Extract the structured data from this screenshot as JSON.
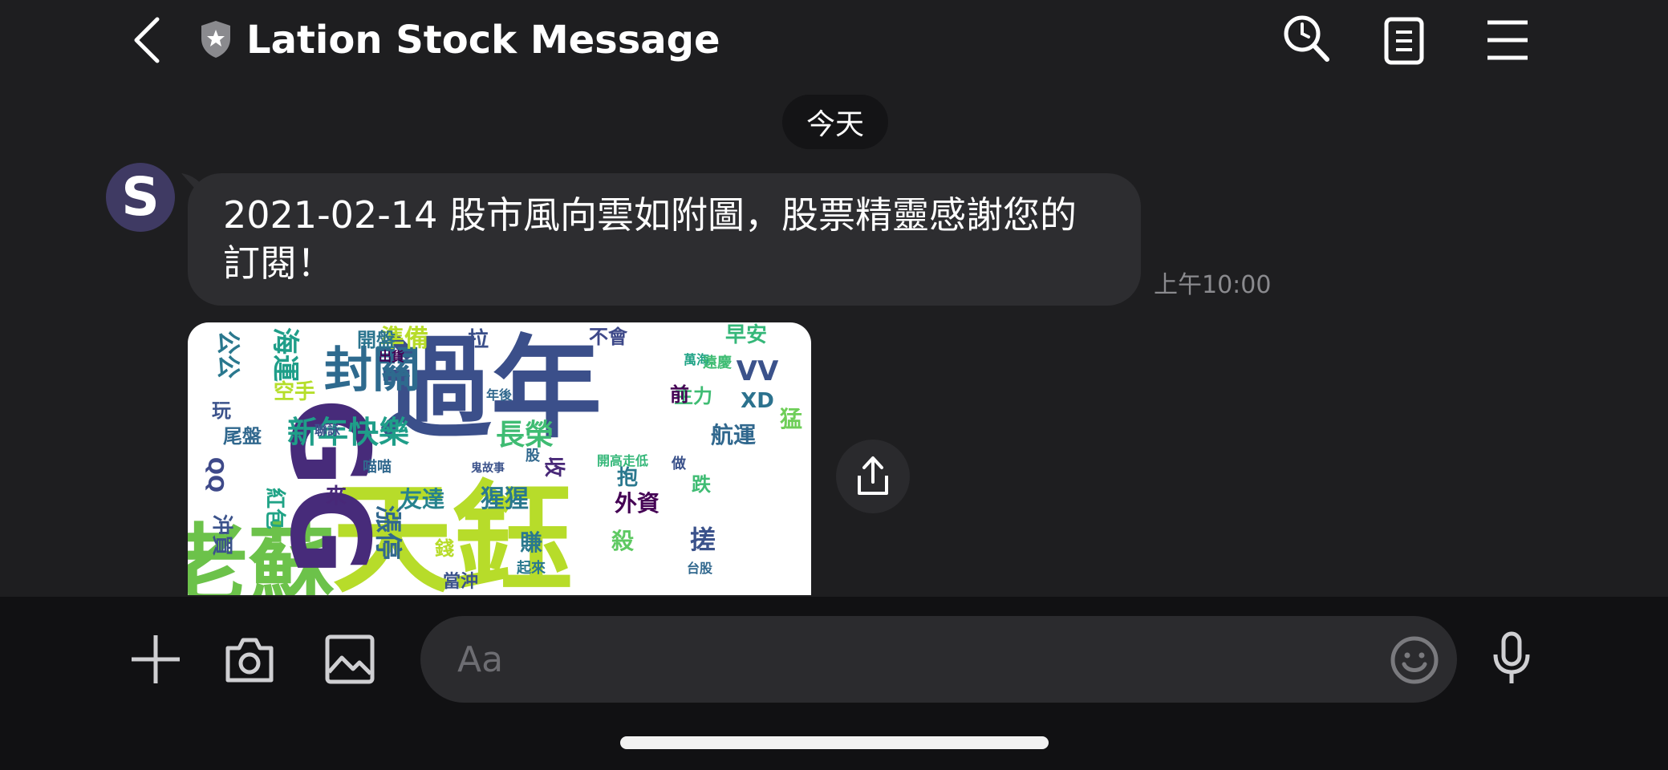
{
  "header": {
    "title": "Lation Stock Message",
    "icons": [
      "back-chevron-icon",
      "verified-shield-icon",
      "search-clock-icon",
      "notes-icon",
      "menu-icon"
    ]
  },
  "chat": {
    "date_label": "今天",
    "avatar_letter": "S",
    "message_text": "2021-02-14 股市風向雲如附圖，股票精靈感謝您的訂閱！",
    "message_time": "上午10:00",
    "wordcloud_words": [
      {
        "text": "過年",
        "color": "#3b4f8a"
      },
      {
        "text": "天鈺",
        "color": "#b7dc2a"
      },
      {
        "text": "老蘇",
        "color": "#6cc24a"
      },
      {
        "text": "GG",
        "color": "#472b7a"
      },
      {
        "text": "封關",
        "color": "#2e6a8e"
      },
      {
        "text": "新年快樂",
        "color": "#1f9e89"
      },
      {
        "text": "長榮",
        "color": "#3fbc73"
      },
      {
        "text": "準備",
        "color": "#b7dc2a"
      },
      {
        "text": "開盤",
        "color": "#2b748e"
      },
      {
        "text": "拉",
        "color": "#3b4f8a"
      },
      {
        "text": "不會",
        "color": "#3e4989"
      },
      {
        "text": "早安",
        "color": "#35b779"
      },
      {
        "text": "VV",
        "color": "#3b528b"
      },
      {
        "text": "XD",
        "color": "#2c728e"
      },
      {
        "text": "主力",
        "color": "#3fbc73"
      },
      {
        "text": "航運",
        "color": "#31688e"
      },
      {
        "text": "猛",
        "color": "#6ece58"
      },
      {
        "text": "海運",
        "color": "#1f9e89"
      },
      {
        "text": "公公",
        "color": "#2a788e"
      },
      {
        "text": "空手",
        "color": "#b5de2b"
      },
      {
        "text": "玩",
        "color": "#3b528b"
      },
      {
        "text": "尾盤",
        "color": "#31688e"
      },
      {
        "text": "QQ",
        "color": "#3e4989"
      },
      {
        "text": "紅包",
        "color": "#20a386"
      },
      {
        "text": "沖買",
        "color": "#3b528b"
      },
      {
        "text": "漲停",
        "color": "#31688e"
      },
      {
        "text": "友達",
        "color": "#26828e"
      },
      {
        "text": "猩猩",
        "color": "#2a788e"
      },
      {
        "text": "外資",
        "color": "#440154"
      },
      {
        "text": "跌",
        "color": "#3fbc73"
      },
      {
        "text": "搓",
        "color": "#3b528b"
      },
      {
        "text": "殺",
        "color": "#5ec962"
      },
      {
        "text": "賺",
        "color": "#2a788e"
      },
      {
        "text": "錢",
        "color": "#b7dc2a"
      },
      {
        "text": "前",
        "color": "#440154"
      },
      {
        "text": "當沖",
        "color": "#3b528b"
      },
      {
        "text": "收",
        "color": "#482878"
      },
      {
        "text": "來",
        "color": "#482878"
      },
      {
        "text": "抱",
        "color": "#2a788e"
      },
      {
        "text": "開高走低",
        "color": "#35b779"
      },
      {
        "text": "起來",
        "color": "#2a788e"
      },
      {
        "text": "台股",
        "color": "#31688e"
      },
      {
        "text": "做",
        "color": "#3b528b"
      },
      {
        "text": "聯詠",
        "color": "#3b528b"
      },
      {
        "text": "喵喵",
        "color": "#31688e"
      },
      {
        "text": "股",
        "color": "#31688e"
      },
      {
        "text": "出貨",
        "color": "#440154"
      },
      {
        "text": "鬼故事",
        "color": "#3b528b"
      },
      {
        "text": "年後",
        "color": "#31688e"
      },
      {
        "text": "萬海",
        "color": "#20a386"
      },
      {
        "text": "遠慶",
        "color": "#3fbc73"
      }
    ]
  },
  "composer": {
    "placeholder": "Aa",
    "icons": [
      "plus-icon",
      "camera-icon",
      "image-icon",
      "emoji-icon",
      "microphone-icon"
    ]
  },
  "colors": {
    "background": "#1e1e20",
    "bubble": "#2d2d30",
    "bottom_bar": "#111113",
    "avatar": "#3f3a63",
    "time_text": "#8a8a8e"
  }
}
